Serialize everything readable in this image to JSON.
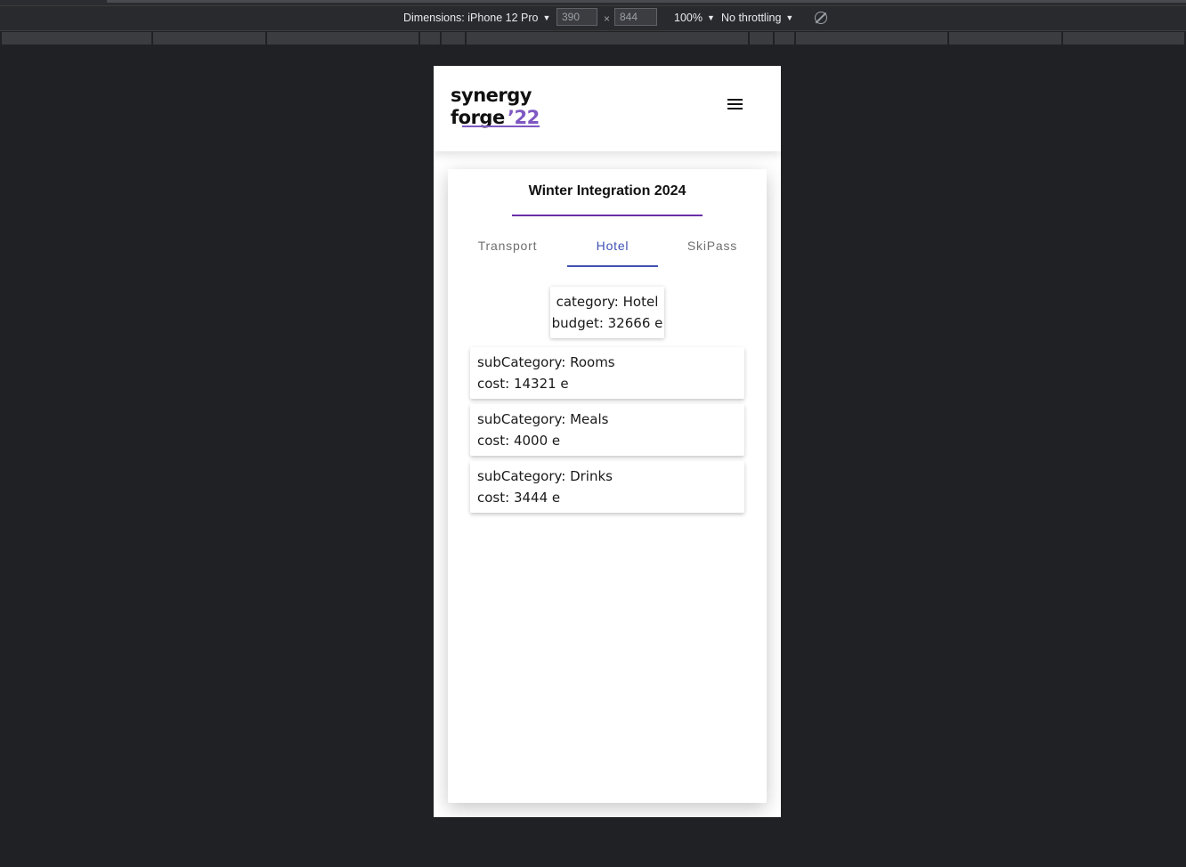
{
  "devtools": {
    "dimensions_label": "Dimensions: iPhone 12 Pro",
    "width": "390",
    "height": "844",
    "times": "×",
    "zoom": "100%",
    "throttling": "No throttling"
  },
  "header": {
    "logo": {
      "line1": "synergy",
      "line2": "forge",
      "year": "’22"
    }
  },
  "page": {
    "title": "Winter Integration 2024",
    "tabs": [
      {
        "label": "Transport",
        "active": false
      },
      {
        "label": "Hotel",
        "active": true
      },
      {
        "label": "SkiPass",
        "active": false
      }
    ],
    "summary": {
      "category": "category: Hotel",
      "budget": "budget: 32666 e"
    },
    "subcategories": [
      {
        "name": "subCategory: Rooms",
        "cost": "cost: 14321 e"
      },
      {
        "name": "subCategory: Meals",
        "cost": "cost: 4000 e"
      },
      {
        "name": "subCategory: Drinks",
        "cost": "cost: 3444 e"
      }
    ]
  },
  "colors": {
    "accent_purple": "#6a2ea8",
    "tab_active": "#3f51b5",
    "logo_purple": "#7e57c2"
  }
}
